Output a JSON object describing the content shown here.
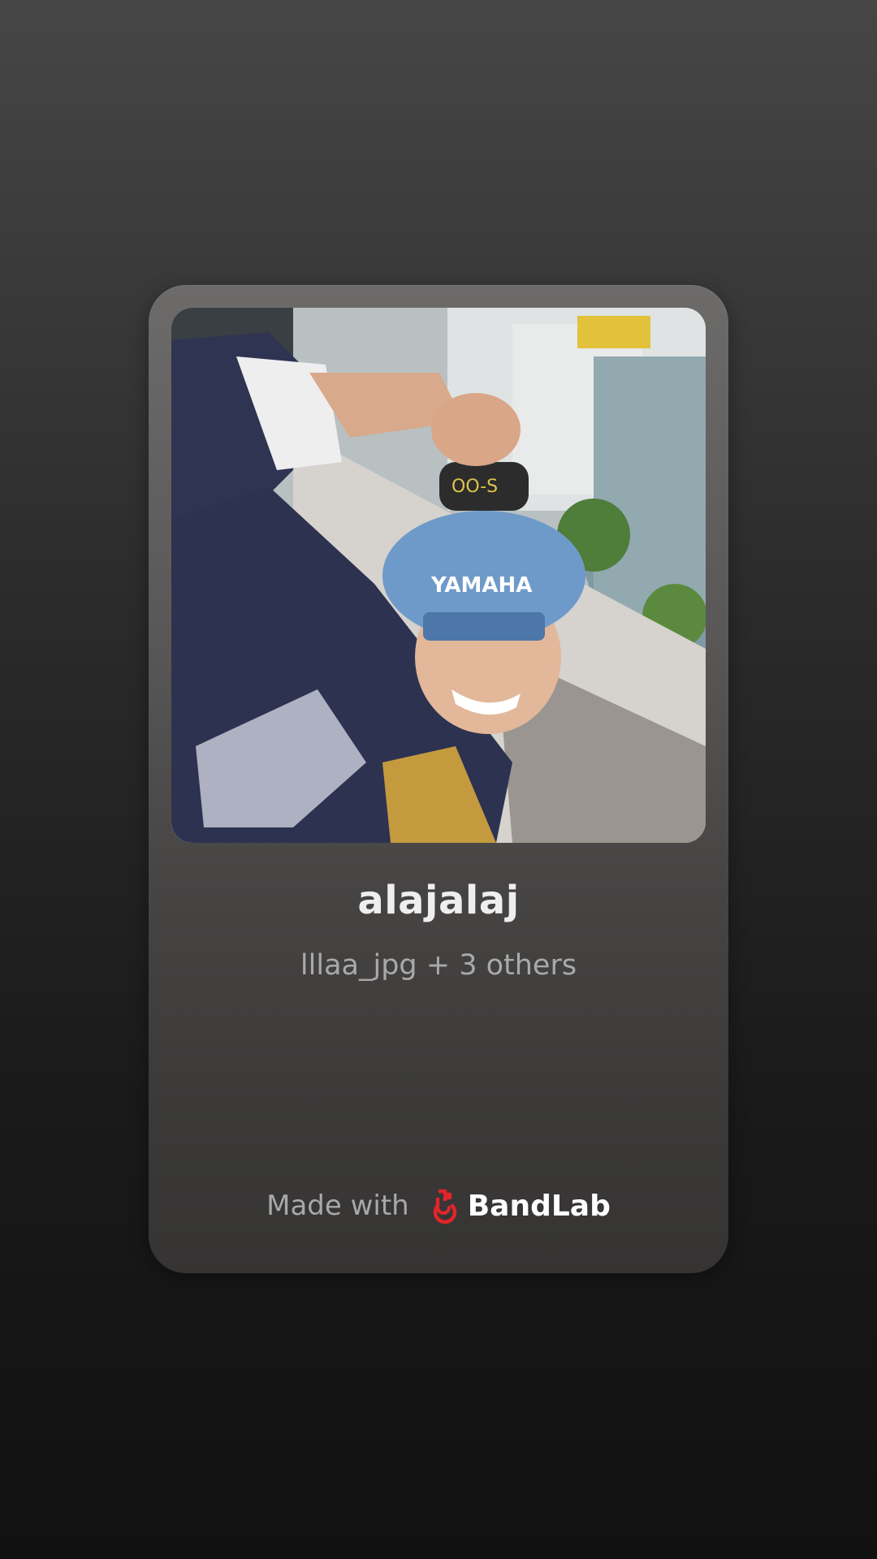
{
  "track": {
    "title": "alajalaj",
    "collaborators": "lllaa_jpg + 3 others",
    "cover_image": "selfie-photo-cover"
  },
  "footer": {
    "made_with_label": "Made with",
    "brand_name": "BandLab",
    "brand_icon": "bandlab-logo-icon"
  },
  "colors": {
    "brand_red": "#e3242b",
    "title_text": "#eeeeee",
    "subtitle_text": "#a9a9a9"
  }
}
